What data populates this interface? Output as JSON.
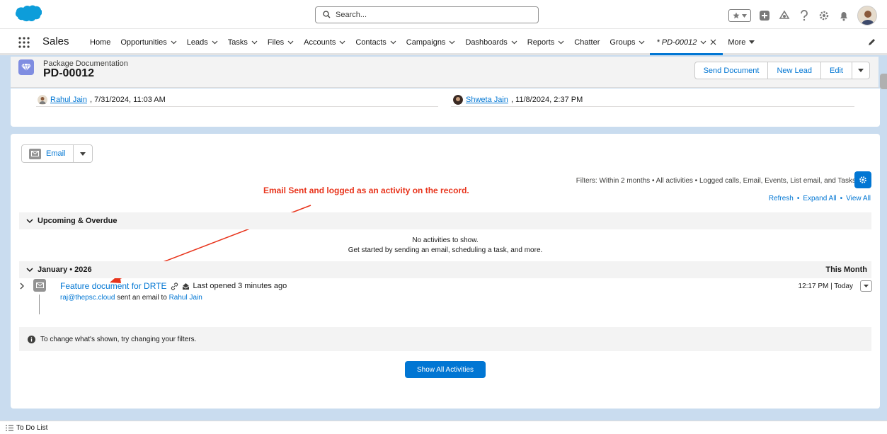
{
  "header": {
    "search_placeholder": "Search..."
  },
  "nav": {
    "app_name": "Sales",
    "items": [
      {
        "label": "Home",
        "dropdown": false
      },
      {
        "label": "Opportunities",
        "dropdown": true
      },
      {
        "label": "Leads",
        "dropdown": true
      },
      {
        "label": "Tasks",
        "dropdown": true
      },
      {
        "label": "Files",
        "dropdown": true
      },
      {
        "label": "Accounts",
        "dropdown": true
      },
      {
        "label": "Contacts",
        "dropdown": true
      },
      {
        "label": "Campaigns",
        "dropdown": true
      },
      {
        "label": "Dashboards",
        "dropdown": true
      },
      {
        "label": "Reports",
        "dropdown": true
      },
      {
        "label": "Chatter",
        "dropdown": false
      },
      {
        "label": "Groups",
        "dropdown": true
      }
    ],
    "active_tab": "* PD-00012",
    "more_label": "More"
  },
  "record": {
    "type": "Package Documentation",
    "name": "PD-00012",
    "actions": {
      "send_document": "Send Document",
      "new_lead": "New Lead",
      "edit": "Edit"
    }
  },
  "details": {
    "created_by_name": "Rahul Jain",
    "created_by_date": ", 7/31/2024, 11:03 AM",
    "modified_by_name": "Shweta Jain",
    "modified_by_date": ", 11/8/2024, 2:37 PM"
  },
  "activity": {
    "email_button": "Email",
    "filters_text": "Filters: Within 2 months • All activities • Logged calls, Email, Events, List email, and Tasks",
    "refresh": "Refresh",
    "expand_all": "Expand All",
    "view_all": "View All",
    "dot": "•",
    "annotation": "Email Sent and logged as an activity on the record.",
    "upcoming_label": "Upcoming & Overdue",
    "no_activities_line1": "No activities to show.",
    "no_activities_line2": "Get started by sending an email, scheduling a task, and more.",
    "month_label": "January • 2026",
    "month_right": "This Month",
    "item": {
      "title": "Feature document for DRTE",
      "opened": "Last opened 3 minutes ago",
      "sender": "raj@thepsc.cloud",
      "sent_text": " sent an email to ",
      "recipient": "Rahul Jain",
      "time": "12:17 PM | Today"
    },
    "info_text": "To change what's shown, try changing your filters.",
    "show_all_button": "Show All Activities"
  },
  "utility": {
    "todo_label": "To Do List"
  },
  "colors": {
    "brand": "#0176d3",
    "annotation": "#e8341c",
    "record_icon": "#7f8de1",
    "page_bg": "#c9dcef"
  }
}
